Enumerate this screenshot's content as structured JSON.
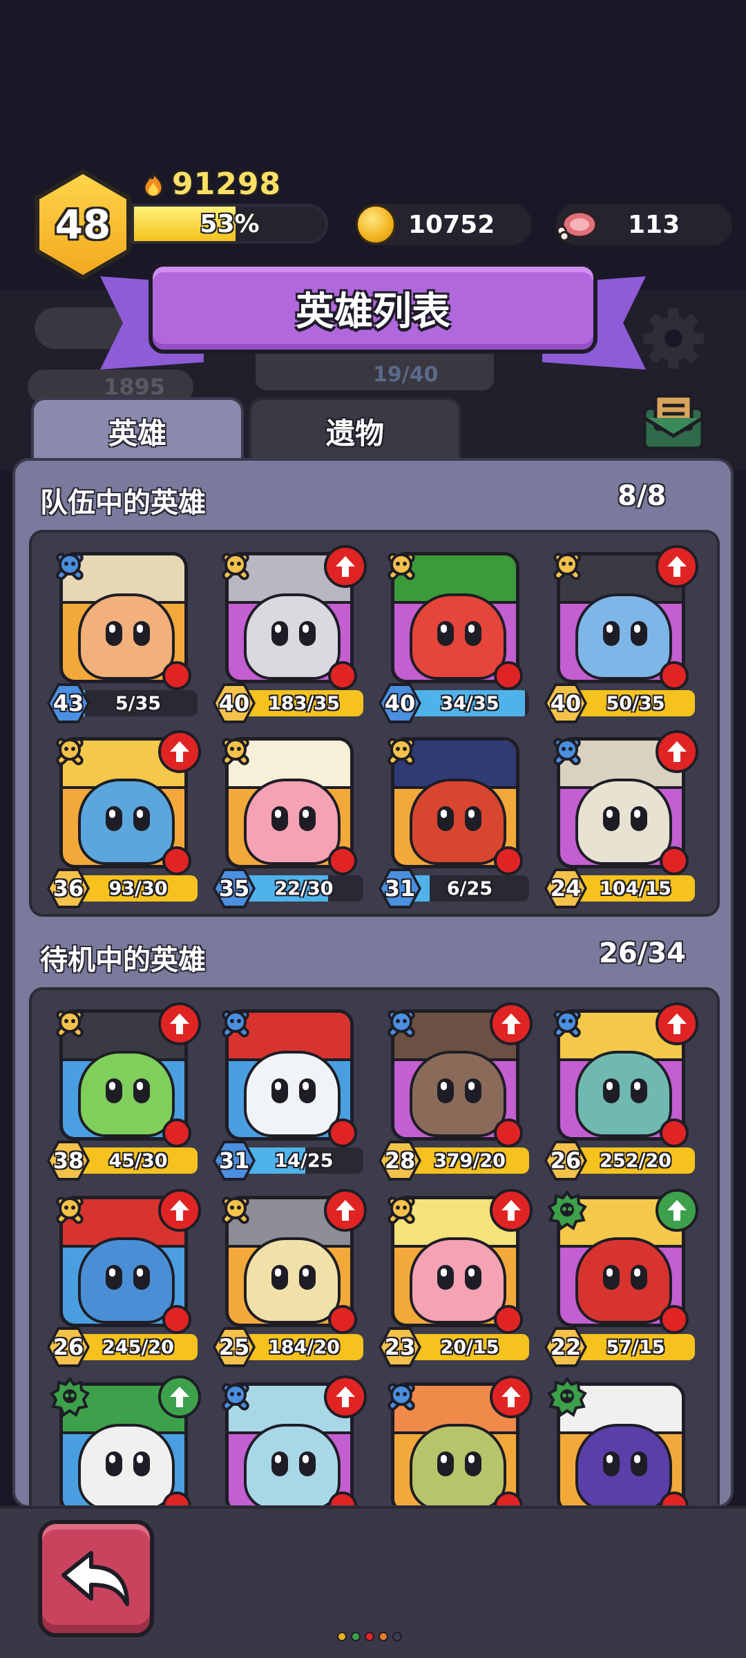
{
  "player": {
    "level": "48",
    "score": "91298",
    "xp_text": "53%",
    "xp_fraction": 0.53
  },
  "resources": {
    "gold": "10752",
    "meat": "113"
  },
  "background": {
    "bar_text": "19/40",
    "meat_count": "1895"
  },
  "title": "英雄列表",
  "tabs": [
    {
      "label": "英雄",
      "active": true
    },
    {
      "label": "遗物",
      "active": false
    }
  ],
  "team_section": {
    "title": "队伍中的英雄",
    "count": "8/8",
    "heroes": [
      {
        "level": "43",
        "progress": "5/35",
        "fill": 0.14,
        "rank": "blue",
        "upgrade": false,
        "bg": "#f3a93a",
        "face": "#f2b07a",
        "hat": "#e7d7b5"
      },
      {
        "level": "40",
        "progress": "183/35",
        "fill": 1,
        "rank": "gold",
        "upgrade": true,
        "bg": "#c35fd1",
        "face": "#d9d9df",
        "hat": "#b8b8c4"
      },
      {
        "level": "40",
        "progress": "34/35",
        "fill": 0.97,
        "rank": "gold",
        "upgrade": false,
        "bg": "#c35fd1",
        "face": "#e5453a",
        "hat": "#3b9b3b"
      },
      {
        "level": "40",
        "progress": "50/35",
        "fill": 1,
        "rank": "gold",
        "upgrade": true,
        "bg": "#c35fd1",
        "face": "#7fb6e8",
        "hat": "#3a3a44"
      },
      {
        "level": "36",
        "progress": "93/30",
        "fill": 1,
        "rank": "gold",
        "upgrade": true,
        "bg": "#f3a93a",
        "face": "#5aa6dd",
        "hat": "#f4c84a"
      },
      {
        "level": "35",
        "progress": "22/30",
        "fill": 0.73,
        "rank": "gold",
        "upgrade": false,
        "bg": "#f3a93a",
        "face": "#f5a2b4",
        "hat": "#f7f0d8"
      },
      {
        "level": "31",
        "progress": "6/25",
        "fill": 0.24,
        "rank": "gold",
        "upgrade": false,
        "bg": "#f3a93a",
        "face": "#d9462f",
        "hat": "#2f3b75"
      },
      {
        "level": "24",
        "progress": "104/15",
        "fill": 1,
        "rank": "blue",
        "upgrade": true,
        "bg": "#c35fd1",
        "face": "#e8e2d2",
        "hat": "#d9d2c0"
      }
    ]
  },
  "bench_section": {
    "title": "待机中的英雄",
    "count": "26/34",
    "heroes": [
      {
        "level": "38",
        "progress": "45/30",
        "fill": 1,
        "rank": "gold",
        "upgrade": true,
        "bg": "#4a9fe0",
        "face": "#7fcf5a",
        "hat": "#3a3a44"
      },
      {
        "level": "31",
        "progress": "14/25",
        "fill": 0.56,
        "rank": "blue",
        "upgrade": false,
        "bg": "#4a9fe0",
        "face": "#f0f4f8",
        "hat": "#d8342f"
      },
      {
        "level": "28",
        "progress": "379/20",
        "fill": 1,
        "rank": "blue",
        "upgrade": true,
        "bg": "#c35fd1",
        "face": "#8a6b5a",
        "hat": "#6b5043"
      },
      {
        "level": "26",
        "progress": "252/20",
        "fill": 1,
        "rank": "blue",
        "upgrade": true,
        "bg": "#c35fd1",
        "face": "#6fb9b0",
        "hat": "#f4c84a"
      },
      {
        "level": "26",
        "progress": "245/20",
        "fill": 1,
        "rank": "gold",
        "upgrade": true,
        "bg": "#4a9fe0",
        "face": "#4a8fd6",
        "hat": "#d8342f"
      },
      {
        "level": "25",
        "progress": "184/20",
        "fill": 1,
        "rank": "gold",
        "upgrade": true,
        "bg": "#f3a93a",
        "face": "#f1e0a8",
        "hat": "#8d8d96"
      },
      {
        "level": "23",
        "progress": "20/15",
        "fill": 1,
        "rank": "gold",
        "upgrade": true,
        "bg": "#f3a93a",
        "face": "#f5a2b4",
        "hat": "#f4e27a"
      },
      {
        "level": "22",
        "progress": "57/15",
        "fill": 1,
        "rank": "green",
        "upgrade": true,
        "bg": "#c35fd1",
        "face": "#d8342f",
        "hat": "#f4c84a"
      },
      {
        "level": "",
        "progress": "",
        "fill": 0,
        "rank": "green",
        "upgrade": true,
        "bg": "#4a9fe0",
        "face": "#f0f0f0",
        "hat": "#3da04a"
      },
      {
        "level": "",
        "progress": "",
        "fill": 0,
        "rank": "blue",
        "upgrade": true,
        "bg": "#c35fd1",
        "face": "#a8d8e8",
        "hat": "#a8d8e8"
      },
      {
        "level": "",
        "progress": "",
        "fill": 0,
        "rank": "blue",
        "upgrade": true,
        "bg": "#f3a93a",
        "face": "#b8c46a",
        "hat": "#f08a4a"
      },
      {
        "level": "",
        "progress": "",
        "fill": 0,
        "rank": "green",
        "upgrade": false,
        "bg": "#f3a93a",
        "face": "#5b3fa8",
        "hat": "#f0f0f0"
      }
    ]
  },
  "colors": {
    "gold_bar": "#f5c21e",
    "blue_bar": "#4fb3ea",
    "gold_badge": "#f4c24a",
    "blue_badge": "#4a8fe0",
    "green_badge": "#3da04a",
    "upgrade_red": "#e02424",
    "upgrade_green": "#3da04a"
  },
  "footer": {
    "back_icon": "back-arrow-icon",
    "page_dots": [
      "#e8b21e",
      "#3da04a",
      "#e02424",
      "#e87a2a",
      "#3d3c4c"
    ]
  }
}
